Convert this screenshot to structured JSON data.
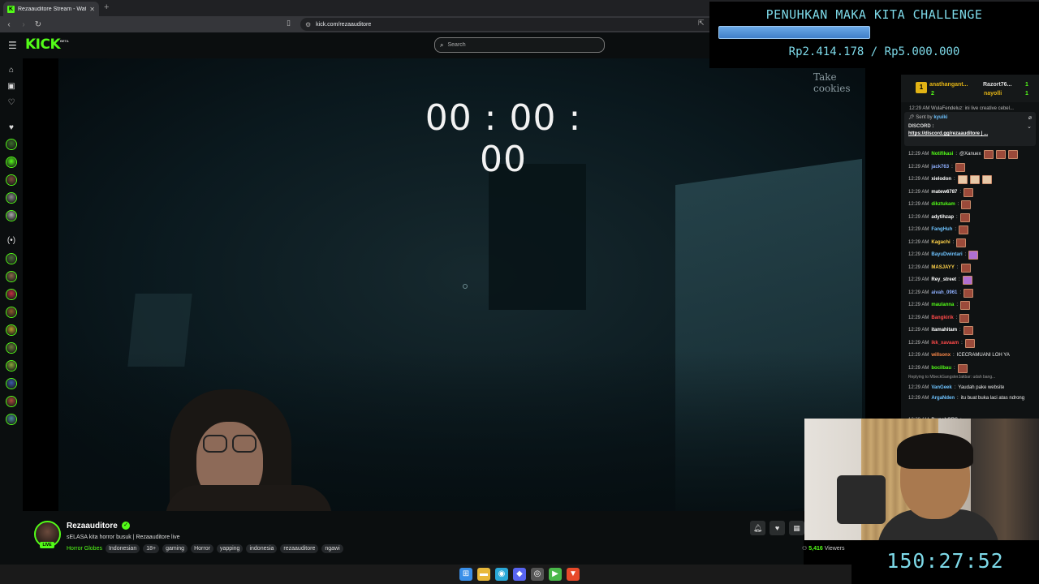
{
  "browser": {
    "tab_title": "Rezaauditore Stream - Watch",
    "tab_favicon": "K",
    "new_tab": "+",
    "url": "kick.com/rezaauditore"
  },
  "header": {
    "logo": "KICK",
    "logo_badge": "BETA",
    "search_placeholder": "Search"
  },
  "sidebar": {
    "icons": [
      "home-icon",
      "browse-icon",
      "heart-icon",
      "heart-icon",
      "live-icon"
    ],
    "avatar_colors": [
      "#3a6b2a",
      "#53fc18",
      "#7a4a3a",
      "#888888",
      "#aaaaaa",
      "#4b6b3a",
      "#8a6a4a",
      "#c03040",
      "#8a5a2a",
      "#b59b2a",
      "#6a7a3a",
      "#8aa83a",
      "#3a5aa8",
      "#a84a3a",
      "#4a8a9a"
    ]
  },
  "stream": {
    "timer": "00 : 00 : 00",
    "overlay_text": "Take cookies",
    "channel_name": "Rezaauditore",
    "live_badge": "LIVE",
    "title": "sELASA kita horror busuk | Rezaauditore live",
    "category": "Horror Globes",
    "tags": [
      "Indonesian",
      "18+",
      "gaming",
      "Horror",
      "yapping",
      "indonesia",
      "rezaauditore",
      "ngawi"
    ],
    "viewers_count": "5,416",
    "viewers_label": "Viewers"
  },
  "goal": {
    "title": "PENUHKAN MAKA KITA CHALLENGE",
    "amount": "Rp2.414.178 / Rp5.000.000",
    "progress": 0.483,
    "bar_color": "#4a8fd8"
  },
  "countdown": "150:27:52",
  "chat": {
    "leaderboard": [
      {
        "rank": "1",
        "name": "anathangant...",
        "count": "2"
      },
      {
        "name": "Razort76...",
        "count": "1"
      },
      {
        "name": "nayolli",
        "count": "1"
      }
    ],
    "top_snippet": "12:29 AM WulaFendeluz: ini live creative cebel...",
    "pinned": {
      "sent_by": "Sent by",
      "sender": "kyuiki",
      "label": "DISCORD :",
      "link": "https://discord.gg/rezaauditore | ..."
    },
    "messages": [
      {
        "time": "12:29 AM",
        "user": "Notifikasi",
        "color": "#53fc18",
        "text": "@Xanuex",
        "emotes": 3
      },
      {
        "time": "12:29 AM",
        "user": "jack763",
        "color": "#8fb0ff",
        "text": "",
        "emotes": 1
      },
      {
        "time": "12:29 AM",
        "user": "xielodon",
        "color": "#ffffff",
        "text": "",
        "emotes": 3
      },
      {
        "time": "12:29 AM",
        "user": "matew6787",
        "color": "#ffffff",
        "text": "",
        "emotes": 1
      },
      {
        "time": "12:29 AM",
        "user": "dikztukam",
        "color": "#53fc18",
        "text": "",
        "emotes": 1
      },
      {
        "time": "12:29 AM",
        "user": "adytihzap",
        "color": "#ffffff",
        "text": "",
        "emotes": 1
      },
      {
        "time": "12:29 AM",
        "user": "FangHuh",
        "color": "#6ec3ff",
        "text": "",
        "emotes": 1
      },
      {
        "time": "12:29 AM",
        "user": "Kagachi",
        "color": "#ffd24a",
        "text": "",
        "emotes": 1
      },
      {
        "time": "12:29 AM",
        "user": "BayuDwintari",
        "color": "#6ec3ff",
        "text": "",
        "emotes": 1
      },
      {
        "time": "12:29 AM",
        "user": "MASJAYY",
        "color": "#ffd24a",
        "text": "",
        "emotes": 1
      },
      {
        "time": "12:29 AM",
        "user": "Rey_street",
        "color": "#ffffff",
        "text": "",
        "emotes": 1
      },
      {
        "time": "12:29 AM",
        "user": "aivah_0961",
        "color": "#8fb0ff",
        "text": "",
        "emotes": 1
      },
      {
        "time": "12:29 AM",
        "user": "maulanna",
        "color": "#53fc18",
        "text": "",
        "emotes": 1
      },
      {
        "time": "12:29 AM",
        "user": "Bangkirik",
        "color": "#ff4a4a",
        "text": "",
        "emotes": 1
      },
      {
        "time": "12:29 AM",
        "user": "itamahitam",
        "color": "#ffffff",
        "text": "",
        "emotes": 1
      },
      {
        "time": "12:29 AM",
        "user": "ikk_xavaam",
        "color": "#ff4a4a",
        "text": "",
        "emotes": 1
      },
      {
        "time": "12:29 AM",
        "user": "willsonx",
        "color": "#ff8a4a",
        "text": "ICECRAMUANI LOH YA",
        "emotes": 0
      },
      {
        "time": "12:29 AM",
        "user": "bocilbau",
        "color": "#53fc18",
        "text": "",
        "emotes": 1
      }
    ],
    "reply_note": "Replying to MbeckGangsterJakbar: udah bang...",
    "reply_msg": {
      "time": "12:29 AM",
      "user": "VanGeek",
      "color": "#6ec3ff",
      "text": "Yaudah pake website"
    },
    "last_msg": {
      "time": "12:29 AM",
      "user": "ArgaNden",
      "color": "#6ec3ff",
      "text": "itu buat buka laci atas ndrong"
    },
    "cut_msg": {
      "time": "12:29 AM",
      "user": "DwnahOBS"
    }
  },
  "taskbar": {
    "icons": [
      {
        "name": "windows-start-icon",
        "color": "#3a8fe8",
        "glyph": "⊞"
      },
      {
        "name": "file-explorer-icon",
        "color": "#e8b83a",
        "glyph": "▬"
      },
      {
        "name": "edge-browser-icon",
        "color": "#2aa8d8",
        "glyph": "◉"
      },
      {
        "name": "discord-icon",
        "color": "#5865f2",
        "glyph": "◆"
      },
      {
        "name": "obs-icon",
        "color": "#555555",
        "glyph": "◎"
      },
      {
        "name": "media-player-icon",
        "color": "#4ab84a",
        "glyph": "▶"
      },
      {
        "name": "brave-browser-icon",
        "color": "#e84a2a",
        "glyph": "▼"
      }
    ]
  }
}
